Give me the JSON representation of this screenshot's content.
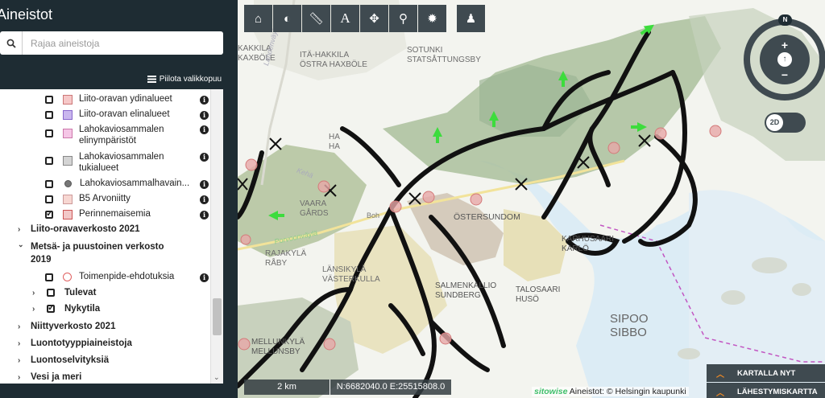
{
  "sidebar": {
    "title": "Aineistot",
    "search_placeholder": "Rajaa aineistoja",
    "hide_menu": "Piilota valikkopuu",
    "layers": [
      {
        "label": "Liito-oravan ydinalueet",
        "checked": false,
        "color": "#f6c8c8"
      },
      {
        "label": "Liito-oravan elinalueet",
        "checked": false,
        "color": "#c9b6ee"
      },
      {
        "label": "Lahokaviosammalen",
        "label2": "elinympäristöt",
        "checked": false,
        "color": "#f5c6e6"
      },
      {
        "label": "Lahokaviosammalen",
        "label2": "tukialueet",
        "checked": false,
        "color": "#d4d4d4"
      },
      {
        "label": "Lahokaviosammalhavain...",
        "checked": false,
        "color": "#777777"
      },
      {
        "label": "B5 Arvoniitty",
        "checked": false,
        "color": "#f7d7d2"
      },
      {
        "label": "Perinnemaisemia",
        "checked": true,
        "color": "#f2c8c8"
      }
    ],
    "groups": [
      {
        "label": "Liito-oravaverkosto 2021"
      },
      {
        "label": "Metsä- ja puustoinen verkosto",
        "label2": "2019"
      },
      {
        "label": "Toimenpide-ehdotuksia"
      },
      {
        "label": "Tulevat"
      },
      {
        "label": "Nykytila"
      },
      {
        "label": "Niittyverkosto 2021"
      },
      {
        "label": "Luontotyyppiaineistoja"
      },
      {
        "label": "Luontoselvityksiä"
      },
      {
        "label": "Vesi ja meri"
      }
    ]
  },
  "map": {
    "labels": [
      "KAKKILA",
      "KAXBÖLE",
      "ITÄ-HAKKILA",
      "ÖSTRA HAXBÖLE",
      "SOTUNKI",
      "STATSÅTTUNGSBY",
      "HA",
      "HA",
      "VAARA",
      "GÅRDS",
      "RAJAKYLÄ",
      "RÅBY",
      "LÄNSIKYLÄ",
      "VÄSTERKULLA",
      "ÖSTERSUNDOM",
      "KARHUSAARI",
      "KARLÖ",
      "SALMENKALLIO",
      "SUNDBERG",
      "TALOSAARI",
      "HUSÖ",
      "SIPOO",
      "SIBBO",
      "MELLUNKYLÄ",
      "MELLUNSBY",
      "Kehä",
      "Lahdenväylä",
      "Porvoonväylä",
      "Boh"
    ],
    "toolbar": [
      "home-icon",
      "contrast-icon",
      "ruler-icon",
      "text-icon",
      "move-icon",
      "pin-icon",
      "sun-icon",
      "street-view-icon"
    ],
    "toolbar_text": "A",
    "compass": {
      "north": "N",
      "zoom_in": "+",
      "zoom_out": "−",
      "center": "↑"
    },
    "mode_toggle": "2D",
    "scale": "2 km",
    "coords": "N:6682040.0 E:25515808.0",
    "attribution_brand": "sitowise",
    "attribution": "Aineistot: © Helsingin kaupunki",
    "buttons": [
      "KARTALLA NYT",
      "LÄHESTYMISKARTTA"
    ]
  }
}
